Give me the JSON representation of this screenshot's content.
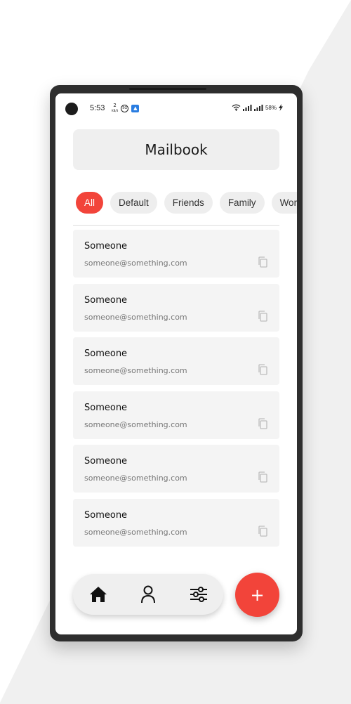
{
  "status_bar": {
    "time": "5:53",
    "net_speed_top": "2",
    "net_speed_unit": "KB/S",
    "circle_badge": "5G",
    "battery": "58%"
  },
  "header": {
    "title": "Mailbook"
  },
  "filters": {
    "selected": "All",
    "chips": [
      "All",
      "Default",
      "Friends",
      "Family",
      "Work"
    ]
  },
  "contacts": [
    {
      "name": "Someone",
      "email": "someone@something.com"
    },
    {
      "name": "Someone",
      "email": "someone@something.com"
    },
    {
      "name": "Someone",
      "email": "someone@something.com"
    },
    {
      "name": "Someone",
      "email": "someone@something.com"
    },
    {
      "name": "Someone",
      "email": "someone@something.com"
    },
    {
      "name": "Someone",
      "email": "someone@something.com"
    }
  ],
  "bottom_nav": {
    "items": [
      {
        "icon": "home-icon"
      },
      {
        "icon": "person-icon"
      },
      {
        "icon": "sliders-icon"
      }
    ]
  },
  "fab": {
    "label": "+"
  },
  "colors": {
    "accent": "#f2443a",
    "card": "#f4f4f4",
    "chip": "#eeeeee",
    "phone_frame": "#2e2e2e"
  }
}
